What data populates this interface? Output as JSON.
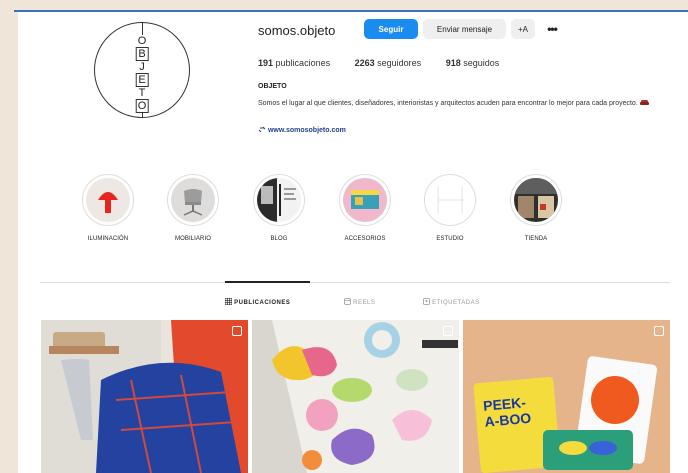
{
  "profile": {
    "avatar_letters": [
      "O",
      "B",
      "J",
      "E",
      "T",
      "O"
    ],
    "username": "somos.objeto",
    "follow_label": "Seguir",
    "message_label": "Enviar mensaje",
    "add_user_label": "+A",
    "more_label": "•••",
    "posts_count": "191",
    "posts_label": "publicaciones",
    "followers_count": "2263",
    "followers_label": "seguidores",
    "following_count": "918",
    "following_label": "seguidos",
    "bio_name": "OBJETO",
    "bio_text": "Somos el lugar al que clientes, diseñadores, interioristas y arquitectos acuden para encontrar lo mejor para cada proyecto.",
    "website": "www.somosobjeto.com"
  },
  "highlights": [
    {
      "label": "ILUMINACIÓN"
    },
    {
      "label": "MOBILIARIO"
    },
    {
      "label": "BLOG"
    },
    {
      "label": "ACCESORIOS"
    },
    {
      "label": "ESTUDIO"
    },
    {
      "label": "TIENDA"
    }
  ],
  "tabs": [
    {
      "label": "PUBLICACIONES"
    },
    {
      "label": "REELS"
    },
    {
      "label": "ETIQUETADAS"
    }
  ],
  "posts": [
    {
      "image": "blue-blanket-chair"
    },
    {
      "image": "colorful-stickers"
    },
    {
      "image": "peek-a-boo-cards",
      "text": "PEEK-\nA-BOO"
    }
  ],
  "colors": {
    "accent": "#1a8cf0",
    "link": "#22408a",
    "background": "#efe6d9"
  }
}
